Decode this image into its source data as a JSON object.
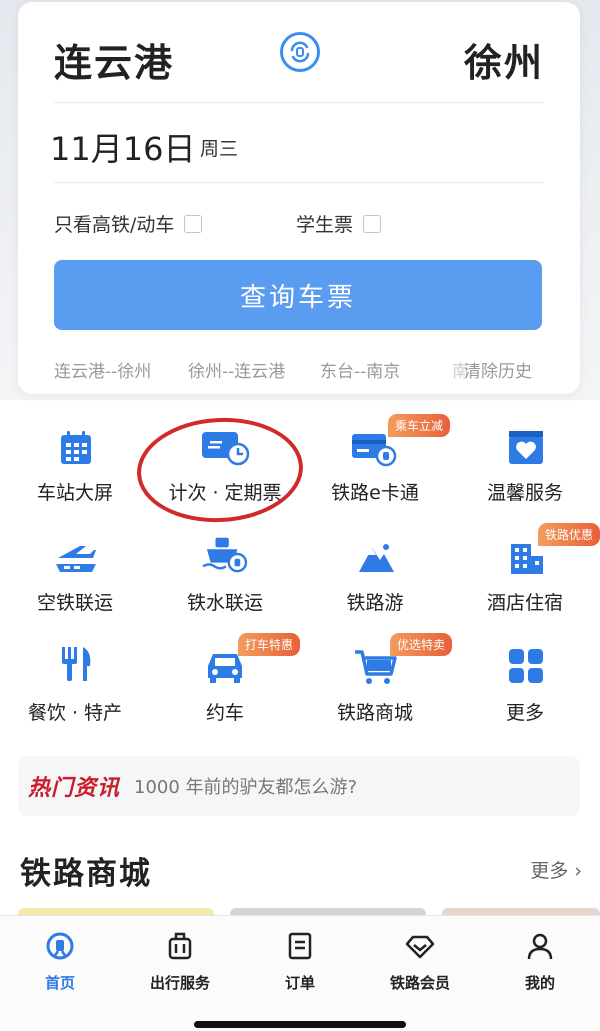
{
  "search": {
    "from_city": "连云港",
    "to_city": "徐州",
    "date": "11月16日",
    "weekday": "周三",
    "option_highspeed": "只看高铁/动车",
    "option_student": "学生票",
    "query_button": "查询车票",
    "history": [
      "连云港--徐州",
      "徐州--连云港",
      "东台--南京"
    ],
    "history_faded": "南",
    "clear_history": "清除历史"
  },
  "services": [
    {
      "label": "车站大屏",
      "icon": "station-screen-icon"
    },
    {
      "label": "计次 · 定期票",
      "icon": "ticket-clock-icon"
    },
    {
      "label": "铁路e卡通",
      "icon": "ecard-icon",
      "badge": "乘车立减"
    },
    {
      "label": "温馨服务",
      "icon": "heart-service-icon"
    },
    {
      "label": "空铁联运",
      "icon": "plane-train-icon"
    },
    {
      "label": "铁水联运",
      "icon": "ship-train-icon"
    },
    {
      "label": "铁路游",
      "icon": "mountain-travel-icon"
    },
    {
      "label": "酒店住宿",
      "icon": "hotel-icon",
      "badge": "铁路优惠"
    },
    {
      "label": "餐饮 · 特产",
      "icon": "fork-knife-icon"
    },
    {
      "label": "约车",
      "icon": "car-icon",
      "badge": "打车特惠"
    },
    {
      "label": "铁路商城",
      "icon": "shopping-cart-icon",
      "badge": "优选特卖"
    },
    {
      "label": "更多",
      "icon": "grid-more-icon"
    }
  ],
  "news": {
    "tag": "热门资讯",
    "text": "1000 年前的驴友都怎么游?"
  },
  "mall": {
    "title": "铁路商城",
    "more": "更多 ›"
  },
  "tabbar": [
    {
      "label": "首页",
      "icon": "home-train-icon",
      "active": true
    },
    {
      "label": "出行服务",
      "icon": "luggage-icon"
    },
    {
      "label": "订单",
      "icon": "order-icon"
    },
    {
      "label": "铁路会员",
      "icon": "diamond-icon"
    },
    {
      "label": "我的",
      "icon": "user-icon"
    }
  ],
  "colors": {
    "primary": "#5a9cf0",
    "icon_blue": "#2e7be6",
    "badge_orange": "#e8603a",
    "annotation_red": "#d02a2a"
  }
}
